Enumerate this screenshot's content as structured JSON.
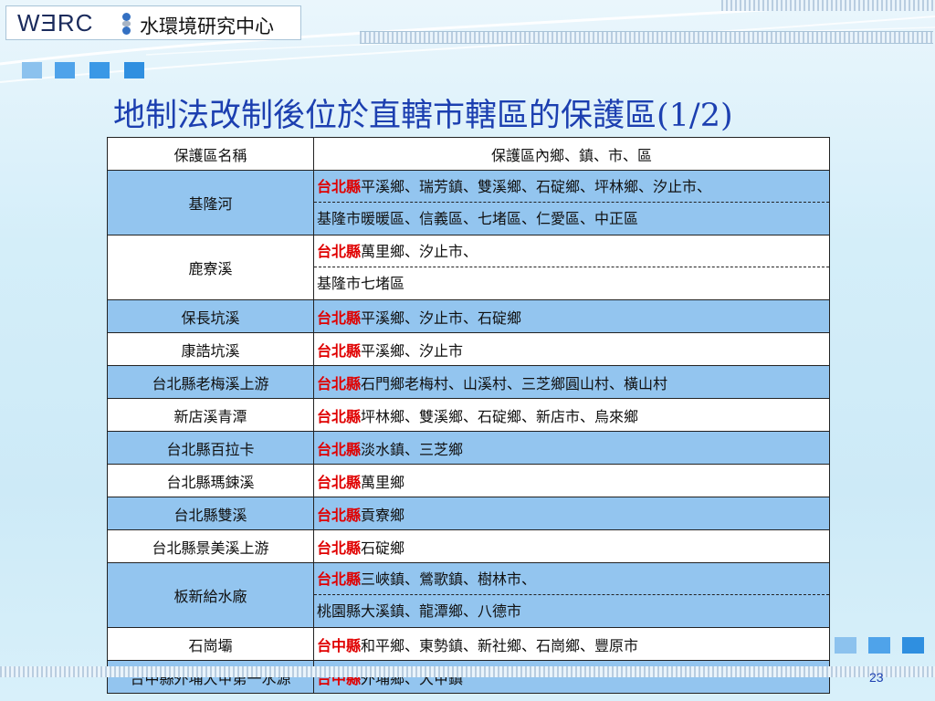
{
  "header": {
    "logo_text": "WƎRC",
    "org_name": "水環境研究中心"
  },
  "title": "地制法改制後位於直轄市轄區的保護區(1/2)",
  "table": {
    "headers": [
      "保護區名稱",
      "保護區內鄉、鎮、市、區"
    ],
    "rows": [
      {
        "name": "基隆河",
        "lines": [
          {
            "county": "台北縣",
            "text": "平溪鄉、瑞芳鎮、雙溪鄉、石碇鄉、坪林鄉、汐止市、"
          },
          {
            "county": "",
            "text": "基隆市暖暖區、信義區、七堵區、仁愛區、中正區"
          }
        ]
      },
      {
        "name": "鹿寮溪",
        "lines": [
          {
            "county": "台北縣",
            "text": "萬里鄉、汐止市、"
          },
          {
            "county": "",
            "text": "基隆市七堵區"
          }
        ]
      },
      {
        "name": "保長坑溪",
        "lines": [
          {
            "county": "台北縣",
            "text": "平溪鄉、汐止市、石碇鄉"
          }
        ]
      },
      {
        "name": "康誥坑溪",
        "lines": [
          {
            "county": "台北縣",
            "text": "平溪鄉、汐止市"
          }
        ]
      },
      {
        "name": "台北縣老梅溪上游",
        "lines": [
          {
            "county": "台北縣",
            "text": "石門鄉老梅村、山溪村、三芝鄉圓山村、橫山村"
          }
        ]
      },
      {
        "name": "新店溪青潭",
        "lines": [
          {
            "county": "台北縣",
            "text": "坪林鄉、雙溪鄉、石碇鄉、新店市、烏來鄉"
          }
        ]
      },
      {
        "name": "台北縣百拉卡",
        "lines": [
          {
            "county": "台北縣",
            "text": "淡水鎮、三芝鄉"
          }
        ]
      },
      {
        "name": "台北縣瑪鋉溪",
        "lines": [
          {
            "county": "台北縣",
            "text": "萬里鄉"
          }
        ]
      },
      {
        "name": "台北縣雙溪",
        "lines": [
          {
            "county": "台北縣",
            "text": "貢寮鄉"
          }
        ]
      },
      {
        "name": "台北縣景美溪上游",
        "lines": [
          {
            "county": "台北縣",
            "text": "石碇鄉"
          }
        ]
      },
      {
        "name": "板新給水廠",
        "lines": [
          {
            "county": "台北縣",
            "text": "三峽鎮、鶯歌鎮、樹林市、"
          },
          {
            "county": "",
            "text": "桃園縣大溪鎮、龍潭鄉、八德市"
          }
        ]
      },
      {
        "name": "石崗壩",
        "lines": [
          {
            "county": "台中縣",
            "text": "和平鄉、東勢鎮、新社鄉、石崗鄉、豐原市"
          }
        ]
      },
      {
        "name": "台中縣外埔大甲第一水源",
        "lines": [
          {
            "county": "台中縣",
            "text": "外埔鄉、大甲鎮"
          }
        ]
      }
    ]
  },
  "footer": {
    "page_number": "23"
  },
  "colors": {
    "title": "#1c3fb0",
    "county": "#e00000",
    "row_blue": "#93c5ef",
    "square_dark": "#2f8fe0",
    "square_light": "#8cc2ee"
  }
}
